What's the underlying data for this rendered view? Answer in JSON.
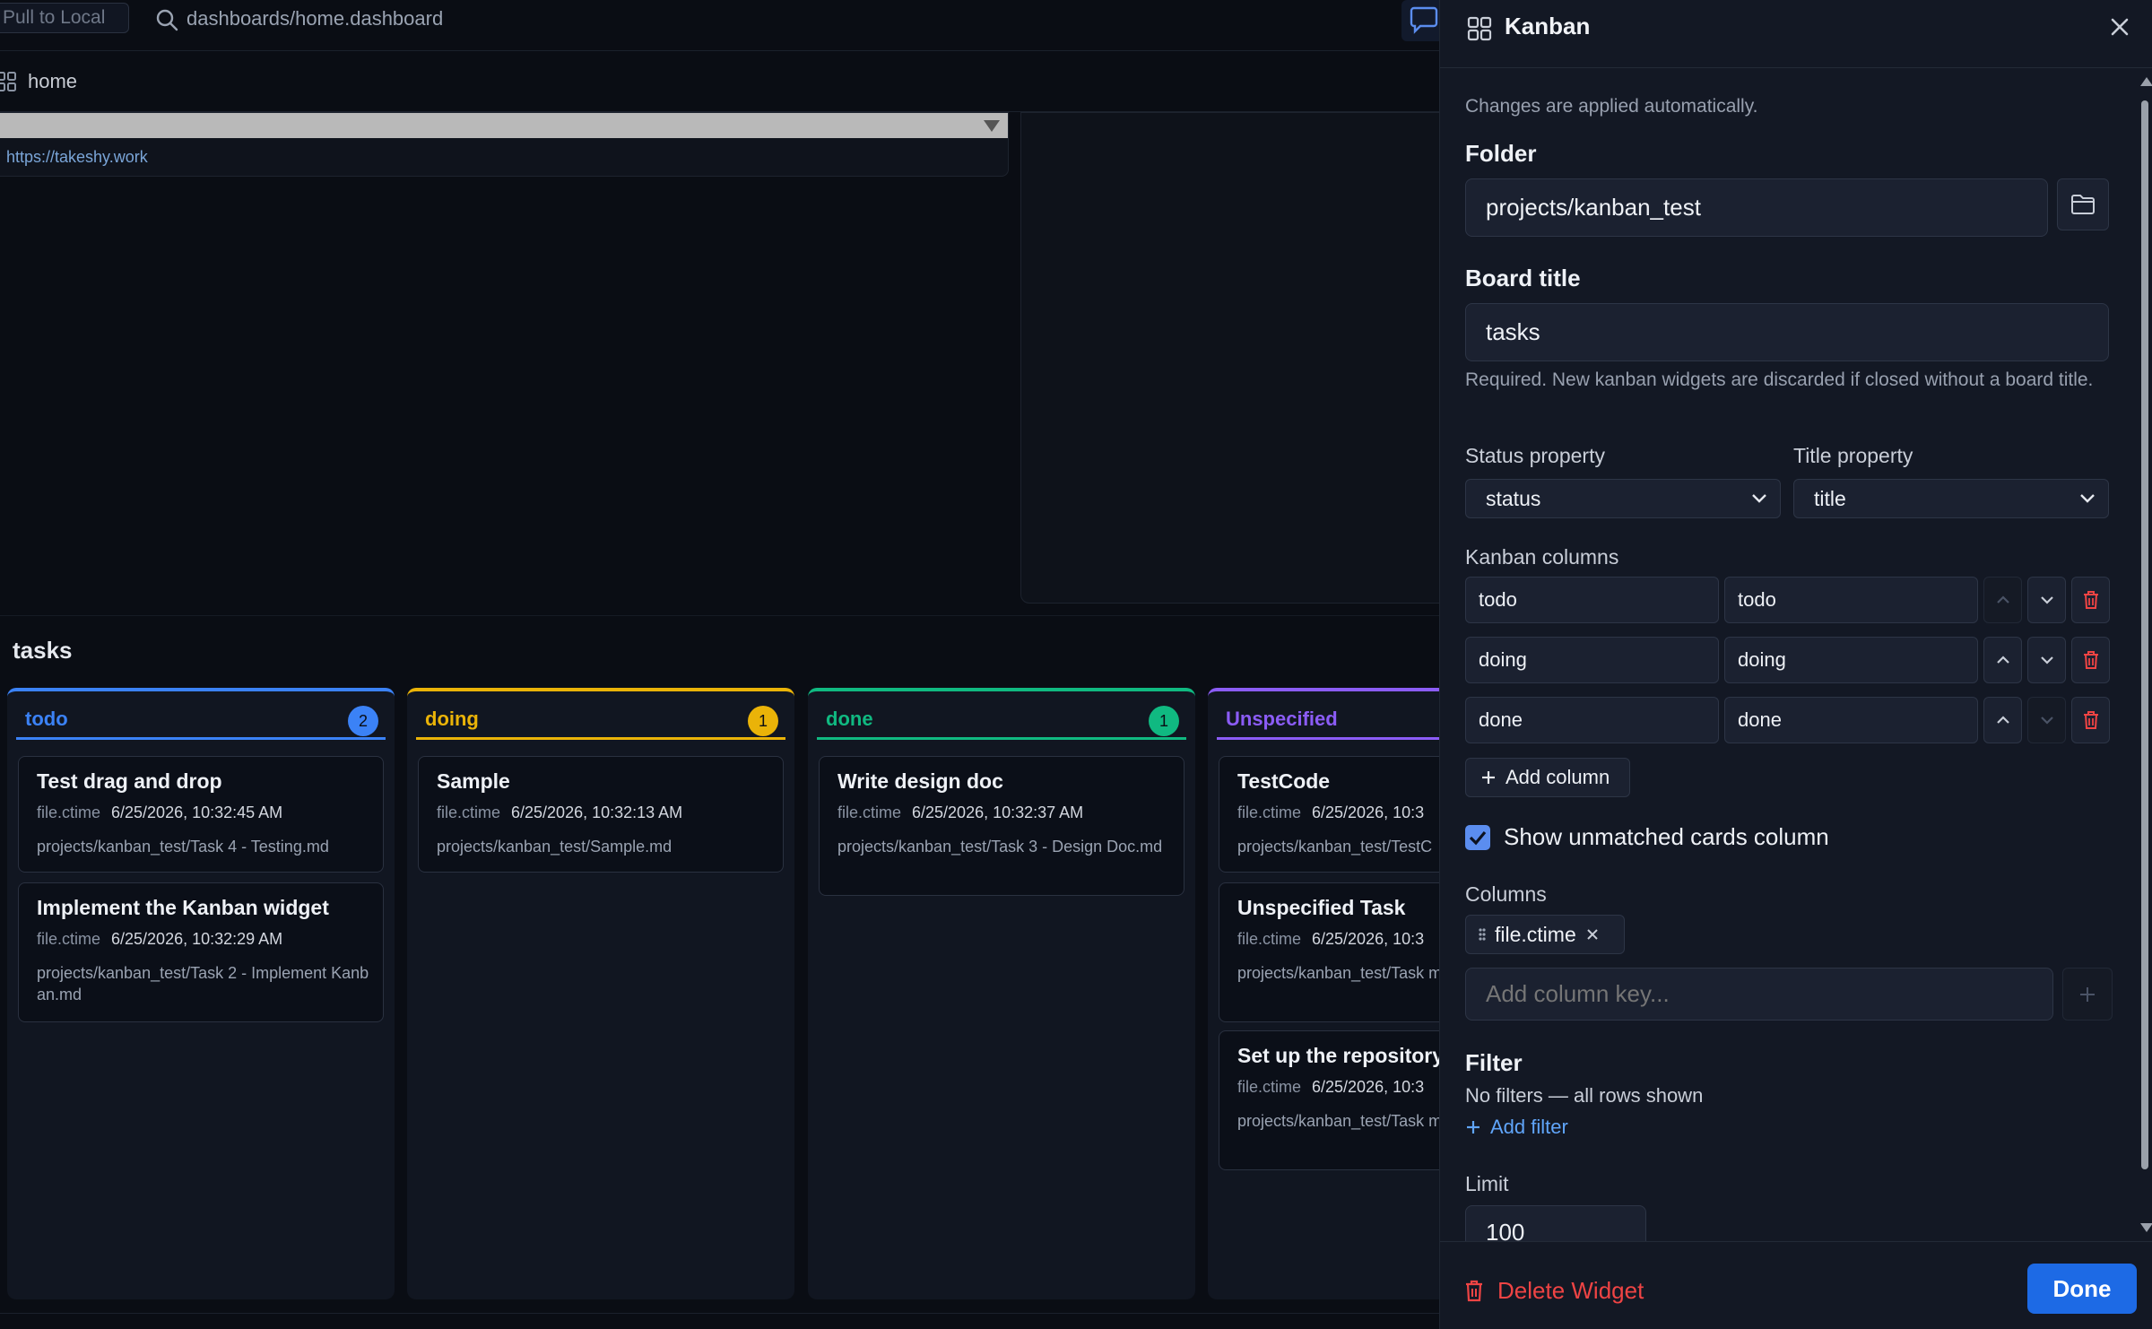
{
  "topbar": {
    "pull_label": "Pull to Local",
    "path": "dashboards/home.dashboard"
  },
  "breadcrumb": {
    "label": "home"
  },
  "embed": {
    "link": "https://takeshy.work"
  },
  "board": {
    "title": "tasks",
    "columns": [
      {
        "name": "todo",
        "count": "2",
        "color": "#3b82f6",
        "cards": [
          {
            "title": "Test drag and drop",
            "meta_key": "file.ctime",
            "meta_value": "6/25/2026, 10:32:45 AM",
            "path": "projects/kanban_test/Task 4 - Testing.md"
          },
          {
            "title": "Implement the Kanban widget",
            "meta_key": "file.ctime",
            "meta_value": "6/25/2026, 10:32:29 AM",
            "path": "projects/kanban_test/Task 2 - Implement Kanban.md"
          }
        ]
      },
      {
        "name": "doing",
        "count": "1",
        "color": "#eab308",
        "cards": [
          {
            "title": "Sample",
            "meta_key": "file.ctime",
            "meta_value": "6/25/2026, 10:32:13 AM",
            "path": "projects/kanban_test/Sample.md"
          }
        ]
      },
      {
        "name": "done",
        "count": "1",
        "color": "#10b981",
        "cards": [
          {
            "title": "Write design doc",
            "meta_key": "file.ctime",
            "meta_value": "6/25/2026, 10:32:37 AM",
            "path": "projects/kanban_test/Task 3 - Design Doc.md"
          }
        ]
      },
      {
        "name": "Unspecified",
        "count": "",
        "color": "#8b5cf6",
        "cards": [
          {
            "title": "TestCode",
            "meta_key": "file.ctime",
            "meta_value": "6/25/2026, 10:3",
            "path": "projects/kanban_test/TestC"
          },
          {
            "title": "Unspecified Task",
            "meta_key": "file.ctime",
            "meta_value": "6/25/2026, 10:3",
            "path": "projects/kanban_test/Task md"
          },
          {
            "title": "Set up the repository",
            "meta_key": "file.ctime",
            "meta_value": "6/25/2026, 10:3",
            "path": "projects/kanban_test/Task md"
          }
        ]
      }
    ]
  },
  "panel": {
    "title": "Kanban",
    "auto_note": "Changes are applied automatically.",
    "folder_label": "Folder",
    "folder_value": "projects/kanban_test",
    "board_title_label": "Board title",
    "board_title_value": "tasks",
    "board_title_hint": "Required. New kanban widgets are discarded if closed without a board title.",
    "status_property_label": "Status property",
    "status_property_value": "status",
    "title_property_label": "Title property",
    "title_property_value": "title",
    "kanban_columns_label": "Kanban columns",
    "kanban_columns": [
      {
        "key": "todo",
        "label": "todo"
      },
      {
        "key": "doing",
        "label": "doing"
      },
      {
        "key": "done",
        "label": "done"
      }
    ],
    "add_column_label": "Add column",
    "show_unmatched_label": "Show unmatched cards column",
    "show_unmatched_checked": true,
    "columns_label": "Columns",
    "column_chip": "file.ctime",
    "add_column_key_placeholder": "Add column key...",
    "filter_label": "Filter",
    "filter_status": "No filters — all rows shown",
    "add_filter_label": "Add filter",
    "limit_label": "Limit",
    "limit_value": "100",
    "delete_label": "Delete Widget",
    "done_label": "Done"
  },
  "colors": {
    "accent": "#1d6ae5",
    "danger": "#ef4444",
    "link": "#60a5fa"
  }
}
